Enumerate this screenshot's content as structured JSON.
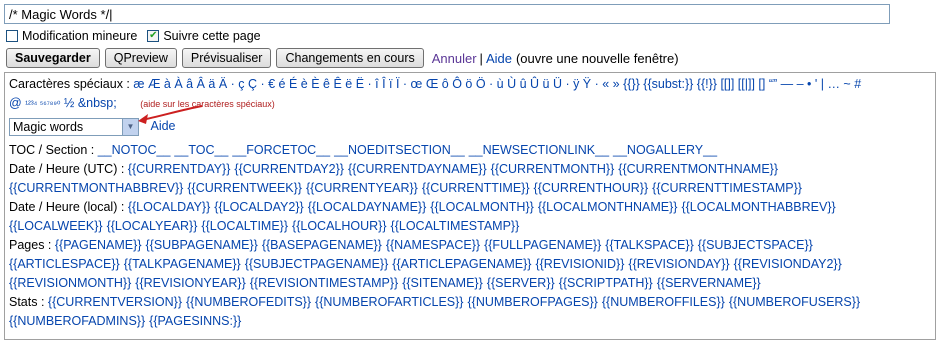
{
  "summary": {
    "value": "/* Magic Words */|"
  },
  "options": {
    "minor_label": "Modification mineure",
    "minor_checked": false,
    "watch_label": "Suivre cette page",
    "watch_checked": true
  },
  "buttons": {
    "save": "Sauvegarder",
    "qpreview": "QPreview",
    "preview": "Prévisualiser",
    "diff": "Changements en cours",
    "cancel": "Annuler",
    "help": "Aide",
    "help_note": "(ouvre une nouvelle fenêtre)"
  },
  "charinsert": {
    "label": "Caractères spéciaux :",
    "line1": "æ Æ à À â Â ä Ä · ç Ç · € é É è È ê Ê ë Ë · î Î ï Ï · œ Œ ô Ô ö Ö · ù Ù û Û ü Ü · ÿ Ÿ · « » {{}} {{subst:}} {{!}} [[]] [[|]] [] “” — – • ' | … ~ #",
    "line2_at": "@",
    "line2_sup": "¹²³⁴ ⁵⁶⁷⁸⁹⁰",
    "line2_rest": "½ &nbsp;",
    "line2_note": "(aide sur les caractères spéciaux)"
  },
  "selector": {
    "value": "Magic words",
    "help": "Aide"
  },
  "magic": {
    "toc_label": "TOC / Section :",
    "toc": [
      "__NOTOC__",
      "__TOC__",
      "__FORCETOC__",
      "__NOEDITSECTION__",
      "__NEWSECTIONLINK__",
      "__NOGALLERY__"
    ],
    "utc_label": "Date / Heure (UTC) :",
    "utc1": [
      "{{CURRENTDAY}}",
      "{{CURRENTDAY2}}",
      "{{CURRENTDAYNAME}}",
      "{{CURRENTMONTH}}",
      "{{CURRENTMONTHNAME}}"
    ],
    "utc2": [
      "{{CURRENTMONTHABBREV}}",
      "{{CURRENTWEEK}}",
      "{{CURRENTYEAR}}",
      "{{CURRENTTIME}}",
      "{{CURRENTHOUR}}",
      "{{CURRENTTIMESTAMP}}"
    ],
    "local_label": "Date / Heure (local) :",
    "local1": [
      "{{LOCALDAY}}",
      "{{LOCALDAY2}}",
      "{{LOCALDAYNAME}}",
      "{{LOCALMONTH}}",
      "{{LOCALMONTHNAME}}",
      "{{LOCALMONTHABBREV}}"
    ],
    "local2": [
      "{{LOCALWEEK}}",
      "{{LOCALYEAR}}",
      "{{LOCALTIME}}",
      "{{LOCALHOUR}}",
      "{{LOCALTIMESTAMP}}"
    ],
    "pages_label": "Pages :",
    "pages1": [
      "{{PAGENAME}}",
      "{{SUBPAGENAME}}",
      "{{BASEPAGENAME}}",
      "{{NAMESPACE}}",
      "{{FULLPAGENAME}}",
      "{{TALKSPACE}}",
      "{{SUBJECTSPACE}}"
    ],
    "pages2": [
      "{{ARTICLESPACE}}",
      "{{TALKPAGENAME}}",
      "{{SUBJECTPAGENAME}}",
      "{{ARTICLEPAGENAME}}",
      "{{REVISIONID}}",
      "{{REVISIONDAY}}",
      "{{REVISIONDAY2}}"
    ],
    "pages3": [
      "{{REVISIONMONTH}}",
      "{{REVISIONYEAR}}",
      "{{REVISIONTIMESTAMP}}",
      "{{SITENAME}}",
      "{{SERVER}}",
      "{{SCRIPTPATH}}",
      "{{SERVERNAME}}"
    ],
    "stats_label": "Stats :",
    "stats1": [
      "{{CURRENTVERSION}}",
      "{{NUMBEROFEDITS}}",
      "{{NUMBEROFARTICLES}}",
      "{{NUMBEROFPAGES}}",
      "{{NUMBEROFFILES}}",
      "{{NUMBEROFUSERS}}"
    ],
    "stats2": [
      "{{NUMBEROFADMINS}}",
      "{{PAGESINNS:}}"
    ]
  },
  "colors": {
    "link": "#0645ad",
    "arrow": "#cc2020"
  }
}
